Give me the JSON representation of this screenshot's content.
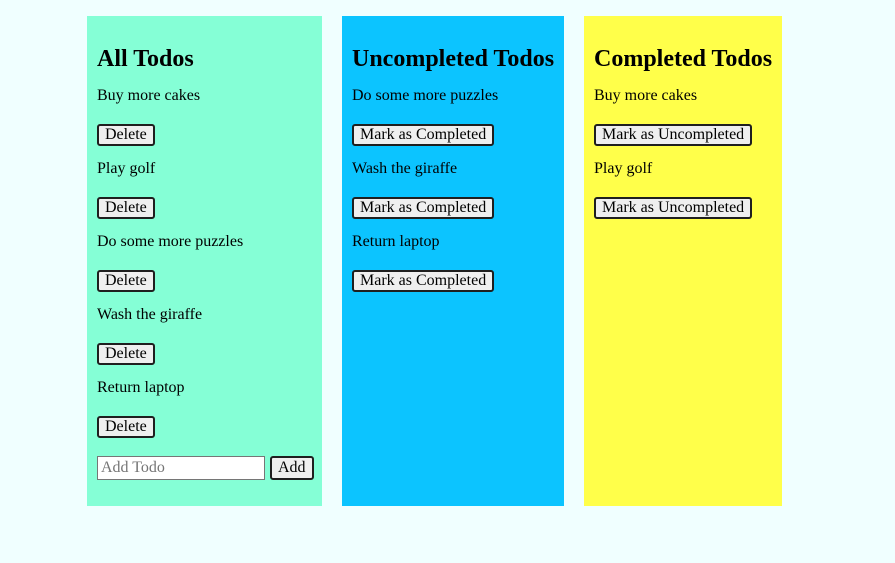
{
  "colors": {
    "page_background": "#f0ffff",
    "all_todos_column": "#85ffd6",
    "uncompleted_todos_column": "#0cc4ff",
    "completed_todos_column": "#ffff4a",
    "button_background": "#efefef"
  },
  "all_todos": {
    "title": "All Todos",
    "items": [
      {
        "text": "Buy more cakes",
        "button_label": "Delete"
      },
      {
        "text": "Play golf",
        "button_label": "Delete"
      },
      {
        "text": "Do some more puzzles",
        "button_label": "Delete"
      },
      {
        "text": "Wash the giraffe",
        "button_label": "Delete"
      },
      {
        "text": "Return laptop",
        "button_label": "Delete"
      }
    ],
    "add_input": {
      "value": "",
      "placeholder": "Add Todo"
    },
    "add_button_label": "Add"
  },
  "uncompleted_todos": {
    "title": "Uncompleted Todos",
    "items": [
      {
        "text": "Do some more puzzles",
        "button_label": "Mark as Completed"
      },
      {
        "text": "Wash the giraffe",
        "button_label": "Mark as Completed"
      },
      {
        "text": "Return laptop",
        "button_label": "Mark as Completed"
      }
    ]
  },
  "completed_todos": {
    "title": "Completed Todos",
    "items": [
      {
        "text": "Buy more cakes",
        "button_label": "Mark as Uncompleted"
      },
      {
        "text": "Play golf",
        "button_label": "Mark as Uncompleted"
      }
    ]
  }
}
